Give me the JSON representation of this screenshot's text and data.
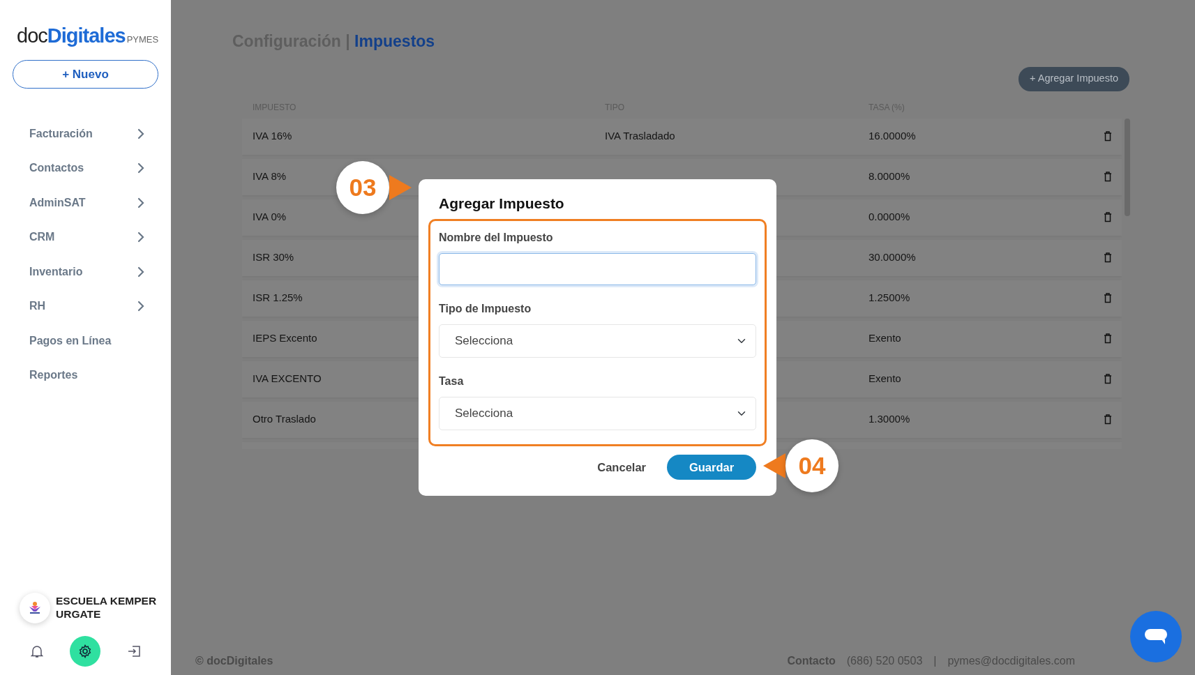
{
  "sidebar": {
    "logo": {
      "doc": "doc",
      "digitales": "Digitales",
      "suffix": "PYMES"
    },
    "new_button": "+ Nuevo",
    "items": [
      {
        "label": "Facturación",
        "expandable": true
      },
      {
        "label": "Contactos",
        "expandable": true
      },
      {
        "label": "AdminSAT",
        "expandable": true
      },
      {
        "label": "CRM",
        "expandable": true
      },
      {
        "label": "Inventario",
        "expandable": true
      },
      {
        "label": "RH",
        "expandable": true
      },
      {
        "label": "Pagos en Línea",
        "expandable": false
      },
      {
        "label": "Reportes",
        "expandable": false
      }
    ],
    "user": {
      "name": "ESCUELA KEMPER URGATE"
    },
    "footer_icons": [
      {
        "kind": "bell",
        "selected": false
      },
      {
        "kind": "gear",
        "selected": true
      },
      {
        "kind": "logout",
        "selected": false
      }
    ]
  },
  "header": {
    "section": "Configuración",
    "separator": "|",
    "page": "Impuestos"
  },
  "add_button": "+ Agregar Impuesto",
  "table": {
    "columns": [
      "IMPUESTO",
      "TIPO",
      "TASA (%)"
    ],
    "rows": [
      {
        "impuesto": "IVA 16%",
        "tipo": "IVA Trasladado",
        "tasa": "16.0000%"
      },
      {
        "impuesto": "IVA 8%",
        "tasa": "8.0000%"
      },
      {
        "impuesto": "IVA 0%",
        "tasa": "0.0000%"
      },
      {
        "impuesto": "ISR 30%",
        "tasa": "30.0000%"
      },
      {
        "impuesto": "ISR 1.25%",
        "tasa": "1.2500%"
      },
      {
        "impuesto": "IEPS Excento",
        "tasa": "Exento"
      },
      {
        "impuesto": "IVA EXCENTO",
        "tasa": "Exento"
      },
      {
        "impuesto": "Otro Traslado",
        "tasa": "1.3000%"
      }
    ]
  },
  "modal": {
    "title": "Agregar Impuesto",
    "fields": [
      {
        "kind": "text",
        "label": "Nombre del Impuesto",
        "focused": true
      },
      {
        "kind": "select",
        "label": "Tipo de Impuesto",
        "value": "Selecciona"
      },
      {
        "kind": "select",
        "label": "Tasa",
        "value": "Selecciona"
      }
    ],
    "buttons": [
      {
        "label": "Cancelar",
        "kind": "secondary"
      },
      {
        "label": "Guardar",
        "kind": "primary"
      }
    ]
  },
  "callouts": [
    {
      "number": "03"
    },
    {
      "number": "04"
    }
  ],
  "footer": {
    "copyright": "© docDigitales",
    "contact_label": "Contacto",
    "phone": "(686) 520 0503",
    "separator": "|",
    "email": "pymes@docdigitales.com"
  }
}
